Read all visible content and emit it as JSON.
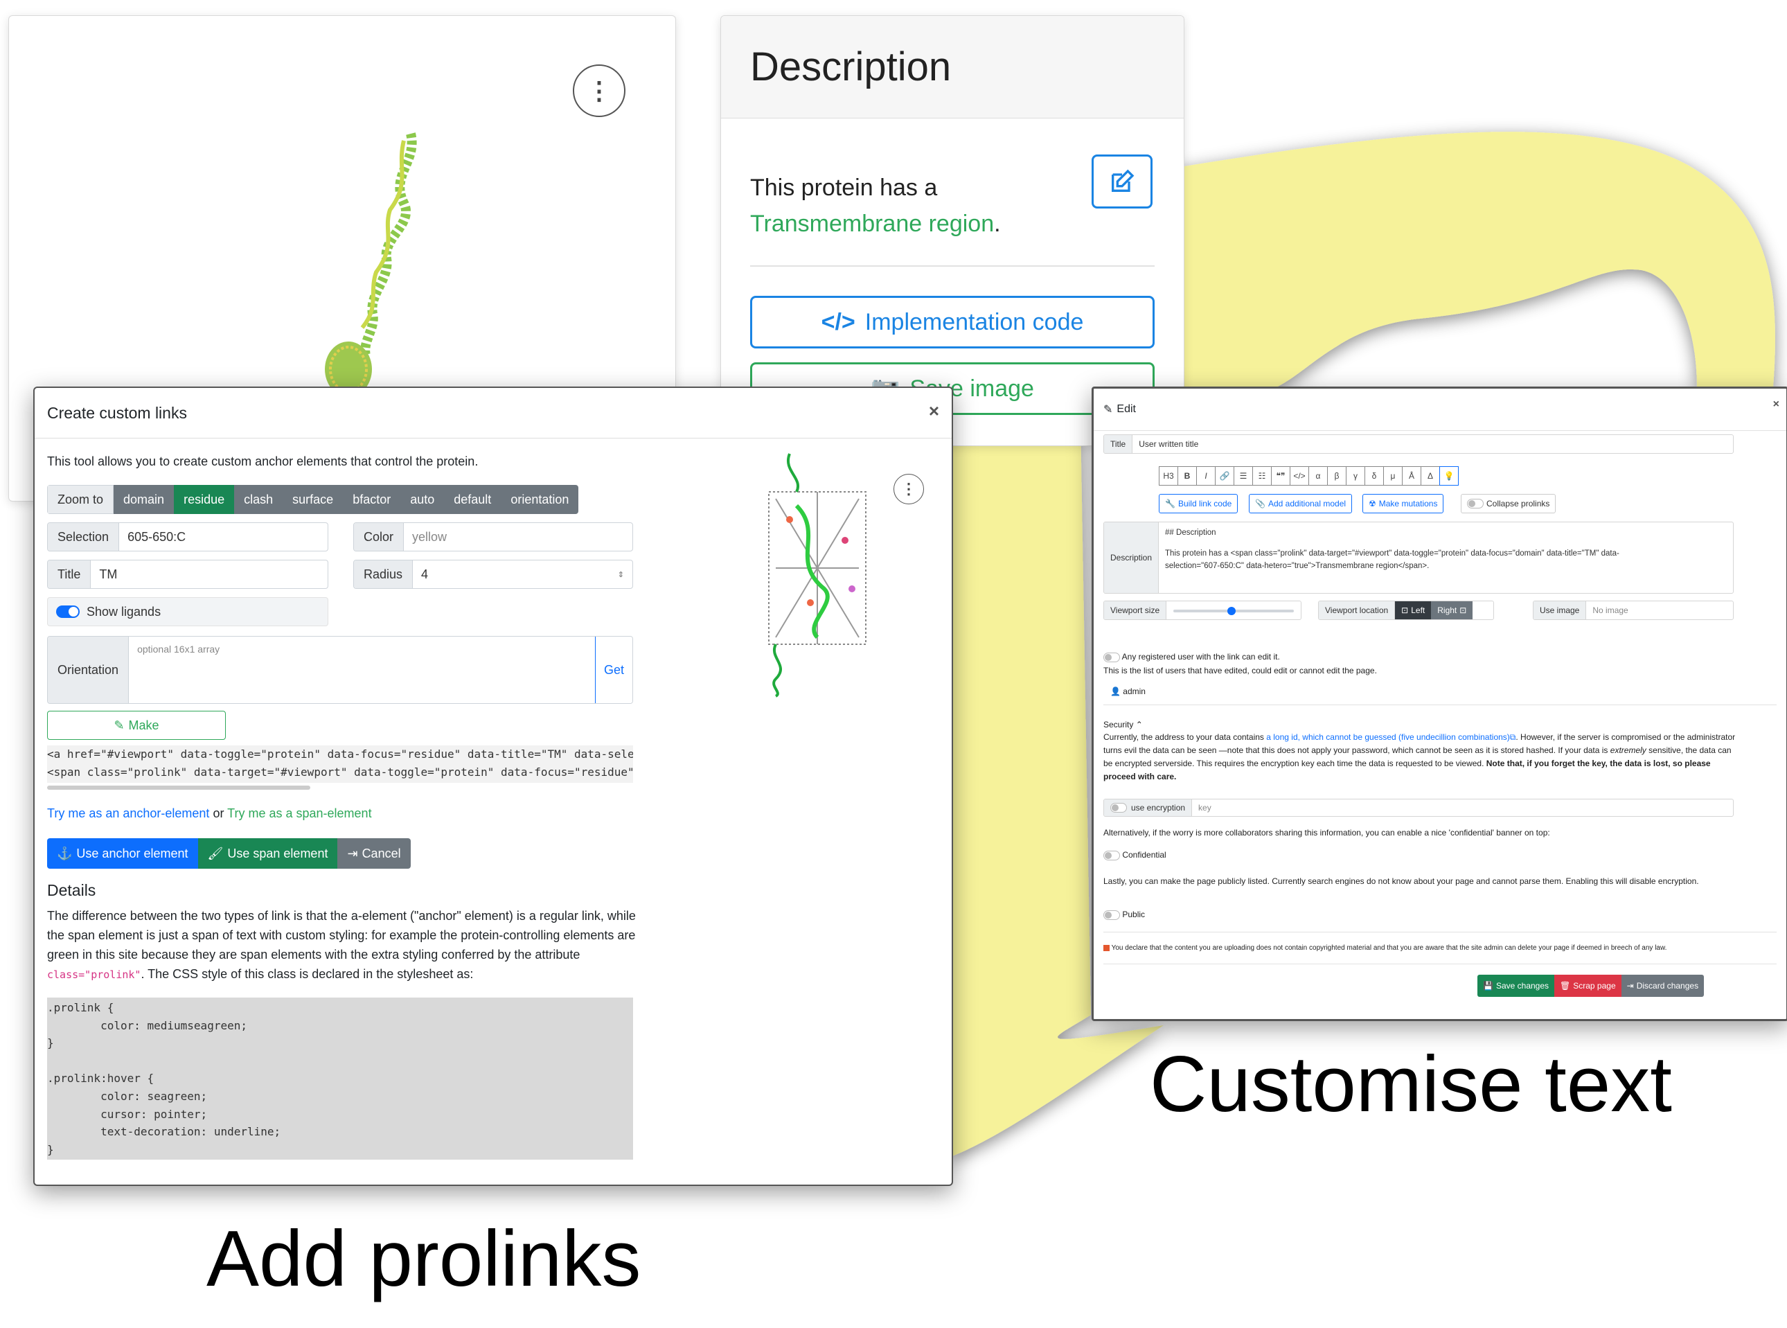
{
  "viewer_card": {
    "menu_glyph": "⋮"
  },
  "description_card": {
    "title": "Description",
    "text_before": "This protein has a",
    "link_text": "Transmembrane region",
    "text_after": ".",
    "implementation_label": "Implementation code",
    "save_image_label": "Save image"
  },
  "links_modal": {
    "title": "Create custom links",
    "close_glyph": "×",
    "intro": "This tool allows you to create custom anchor elements that control the protein.",
    "zoom_label": "Zoom to",
    "zoom_options": [
      "domain",
      "residue",
      "clash",
      "surface",
      "bfactor",
      "auto",
      "default",
      "orientation"
    ],
    "zoom_selected": "residue",
    "selection_label": "Selection",
    "selection_value": "605-650:C",
    "color_label": "Color",
    "color_placeholder": "yellow",
    "title_label": "Title",
    "title_value": "TM",
    "radius_label": "Radius",
    "radius_value": "4",
    "show_ligands_label": "Show ligands",
    "orientation_label": "Orientation",
    "orientation_placeholder": "optional 16x1 array",
    "get_label": "Get",
    "make_label": "Make",
    "code_line_1": "<a href=\"#viewport\" data-toggle=\"protein\" data-focus=\"residue\" data-title=\"TM\" data-selecti",
    "code_line_2": "<span class=\"prolink\" data-target=\"#viewport\" data-toggle=\"protein\" data-focus=\"residue\" da",
    "try_anchor": "Try me as an anchor-element",
    "try_or": "or",
    "try_span": "Try me as a span-element",
    "use_anchor_label": "Use anchor element",
    "use_span_label": "Use span element",
    "cancel_label": "Cancel",
    "details_title": "Details",
    "details_text": "The difference between the two types of link is that the a-element (\"anchor\" element) is a regular link, while the span element is just a span of text with custom styling: for example the protein-controlling elements are green in this site because they are span elements with the extra styling conferred by the attribute",
    "details_code": "class=\"prolink\"",
    "details_text_end": ". The CSS style of this class is declared in the stylesheet as:",
    "css_code": ".prolink {\n        color: mediumseagreen;\n}\n\n.prolink:hover {\n        color: seagreen;\n        cursor: pointer;\n        text-decoration: underline;\n}",
    "menu_glyph": "⋮"
  },
  "edit_modal": {
    "title": "Edit",
    "close_glyph": "×",
    "title_label": "Title",
    "title_value": "User written title",
    "toolbar": [
      "H3",
      "B",
      "I",
      "🔗",
      "☰",
      "☷",
      "❝❞",
      "</>",
      "α",
      "β",
      "γ",
      "δ",
      "μ",
      "Å",
      "Δ",
      "💡"
    ],
    "build_link_label": "Build link code",
    "add_model_label": "Add additional model",
    "make_mutations_label": "Make mutations",
    "collapse_prolinks_label": "Collapse prolinks",
    "description_label": "Description",
    "description_line_1": "## Description",
    "description_line_2": "This protein has a <span class=\"prolink\" data-target=\"#viewport\" data-toggle=\"protein\" data-focus=\"domain\" data-title=\"TM\" data-",
    "description_line_3": "selection=\"607-650:C\" data-hetero=\"true\">Transmembrane region</span>.",
    "viewport_size_label": "Viewport size",
    "viewport_size_value": 0.48,
    "viewport_location_label": "Viewport location",
    "left_label": "Left",
    "right_label": "Right",
    "use_image_label": "Use image",
    "use_image_placeholder": "No image",
    "any_user_label": "Any registered user with the link can edit it.",
    "users_list_text": "This is the list of users that have edited, could edit or cannot edit the page.",
    "user_admin": "admin",
    "security_title": "Security",
    "security_text_1": "Currently, the address to your data contains",
    "security_link": "a long id, which cannot be guessed (five undecillion combinations)",
    "security_text_2": ". However, if the server is compromised or the administrator turns evil the data can be seen —note that this does not apply your password, which cannot be seen as it is stored hashed. If your data is",
    "security_text_3_em": "extremely",
    "security_text_4": "sensitive, the data can be encrypted serverside. This requires the encryption key each time the data is requested to be viewed.",
    "security_text_bold": "Note that, if you forget the key, the data is lost, so please proceed with care.",
    "use_encryption_label": "use encryption",
    "key_placeholder": "key",
    "alt_text": "Alternatively, if the worry is more collaborators sharing this information, you can enable a nice 'confidential' banner on top:",
    "confidential_label": "Confidential",
    "public_text": "Lastly, you can make the page publicly listed. Currently search engines do not know about your page and cannot parse them. Enabling this will disable encryption.",
    "public_label": "Public",
    "declaration_text": "You declare that the content you are uploading does not contain copyrighted material and that you are aware that the site admin can delete your page if deemed in breech of any law.",
    "save_label": "Save changes",
    "scrap_label": "Scrap page",
    "discard_label": "Discard changes"
  },
  "captions": {
    "customise": "Customise text",
    "prolinks": "Add prolinks"
  },
  "colors": {
    "primary": "#0d6efd",
    "success": "#198754",
    "prolink_green": "#2fa85a",
    "secondary": "#6c757d",
    "danger": "#dc3545",
    "highlight_yellow": "#f6f29a"
  }
}
